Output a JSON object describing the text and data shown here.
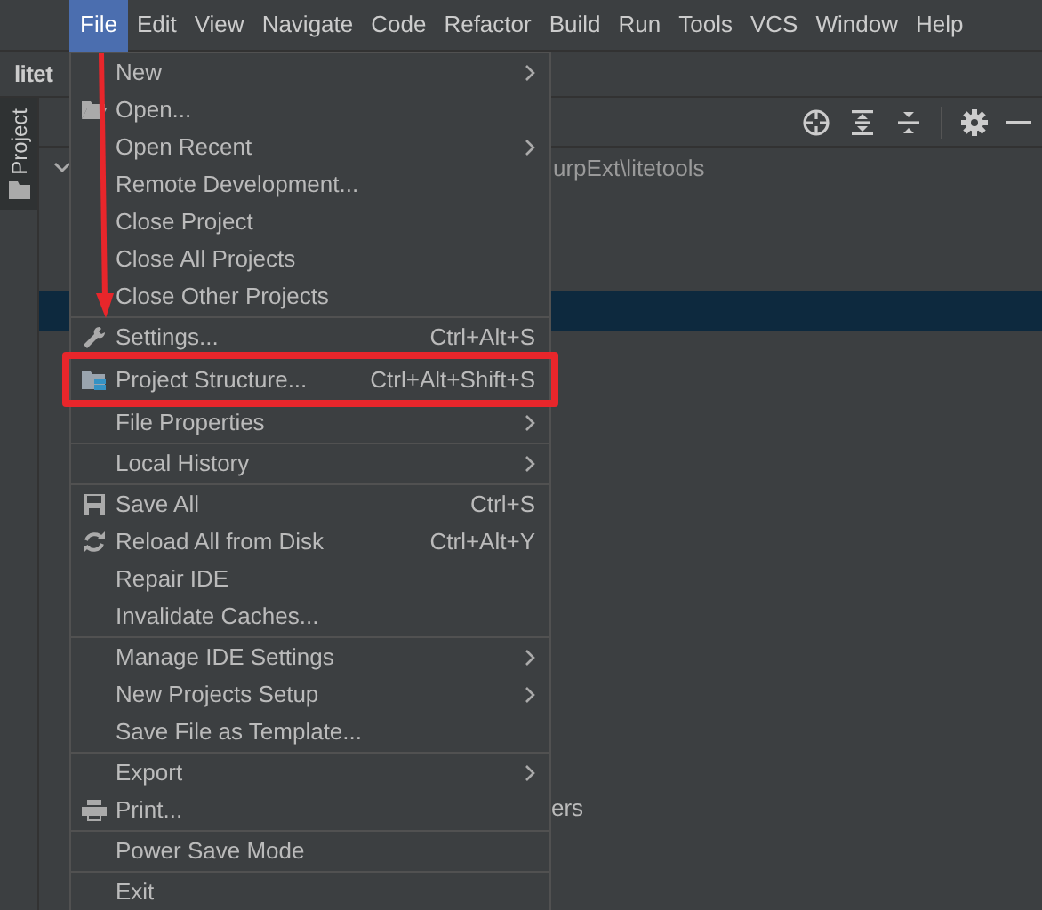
{
  "menubar": [
    {
      "label": "File",
      "selected": true
    },
    {
      "label": "Edit",
      "selected": false
    },
    {
      "label": "View",
      "selected": false
    },
    {
      "label": "Navigate",
      "selected": false
    },
    {
      "label": "Code",
      "selected": false
    },
    {
      "label": "Refactor",
      "selected": false
    },
    {
      "label": "Build",
      "selected": false
    },
    {
      "label": "Run",
      "selected": false
    },
    {
      "label": "Tools",
      "selected": false
    },
    {
      "label": "VCS",
      "selected": false
    },
    {
      "label": "Window",
      "selected": false
    },
    {
      "label": "Help",
      "selected": false
    }
  ],
  "project_title": "litet",
  "side_tab": "Project",
  "tree_path_fragment": "urpExt\\litetools",
  "tree_text_fragment": "ers",
  "menu_groups": [
    [
      {
        "label": "New",
        "kind": "plain",
        "submenu": true,
        "highlighted": false
      },
      {
        "label": "Open...",
        "kind": "folder",
        "submenu": false,
        "highlighted": false
      },
      {
        "label": "Open Recent",
        "kind": "plain",
        "submenu": true,
        "highlighted": false
      },
      {
        "label": "Remote Development...",
        "kind": "plain",
        "submenu": false,
        "highlighted": false
      },
      {
        "label": "Close Project",
        "kind": "plain",
        "submenu": false,
        "highlighted": false
      },
      {
        "label": "Close All Projects",
        "kind": "plain",
        "submenu": false,
        "highlighted": false
      },
      {
        "label": "Close Other Projects",
        "kind": "plain",
        "submenu": false,
        "highlighted": false
      }
    ],
    [
      {
        "label": "Settings...",
        "kind": "wrench",
        "shortcut": "Ctrl+Alt+S",
        "submenu": false,
        "highlighted": false
      },
      {
        "label": "Project Structure...",
        "kind": "structure",
        "shortcut": "Ctrl+Alt+Shift+S",
        "submenu": false,
        "highlighted": true
      },
      {
        "label": "File Properties",
        "kind": "plain",
        "submenu": true,
        "highlighted": false
      }
    ],
    [
      {
        "label": "Local History",
        "kind": "plain",
        "submenu": true,
        "highlighted": false
      }
    ],
    [
      {
        "label": "Save All",
        "kind": "save",
        "shortcut": "Ctrl+S",
        "submenu": false,
        "highlighted": false
      },
      {
        "label": "Reload All from Disk",
        "kind": "reload",
        "shortcut": "Ctrl+Alt+Y",
        "submenu": false,
        "highlighted": false
      },
      {
        "label": "Repair IDE",
        "kind": "plain",
        "submenu": false,
        "highlighted": false
      },
      {
        "label": "Invalidate Caches...",
        "kind": "plain",
        "submenu": false,
        "highlighted": false
      }
    ],
    [
      {
        "label": "Manage IDE Settings",
        "kind": "plain",
        "submenu": true,
        "highlighted": false
      },
      {
        "label": "New Projects Setup",
        "kind": "plain",
        "submenu": true,
        "highlighted": false
      },
      {
        "label": "Save File as Template...",
        "kind": "plain",
        "submenu": false,
        "highlighted": false
      }
    ],
    [
      {
        "label": "Export",
        "kind": "plain",
        "submenu": true,
        "highlighted": false
      },
      {
        "label": "Print...",
        "kind": "print",
        "submenu": false,
        "highlighted": false
      }
    ],
    [
      {
        "label": "Power Save Mode",
        "kind": "plain",
        "submenu": false,
        "highlighted": false
      }
    ],
    [
      {
        "label": "Exit",
        "kind": "plain",
        "submenu": false,
        "highlighted": false
      }
    ]
  ]
}
